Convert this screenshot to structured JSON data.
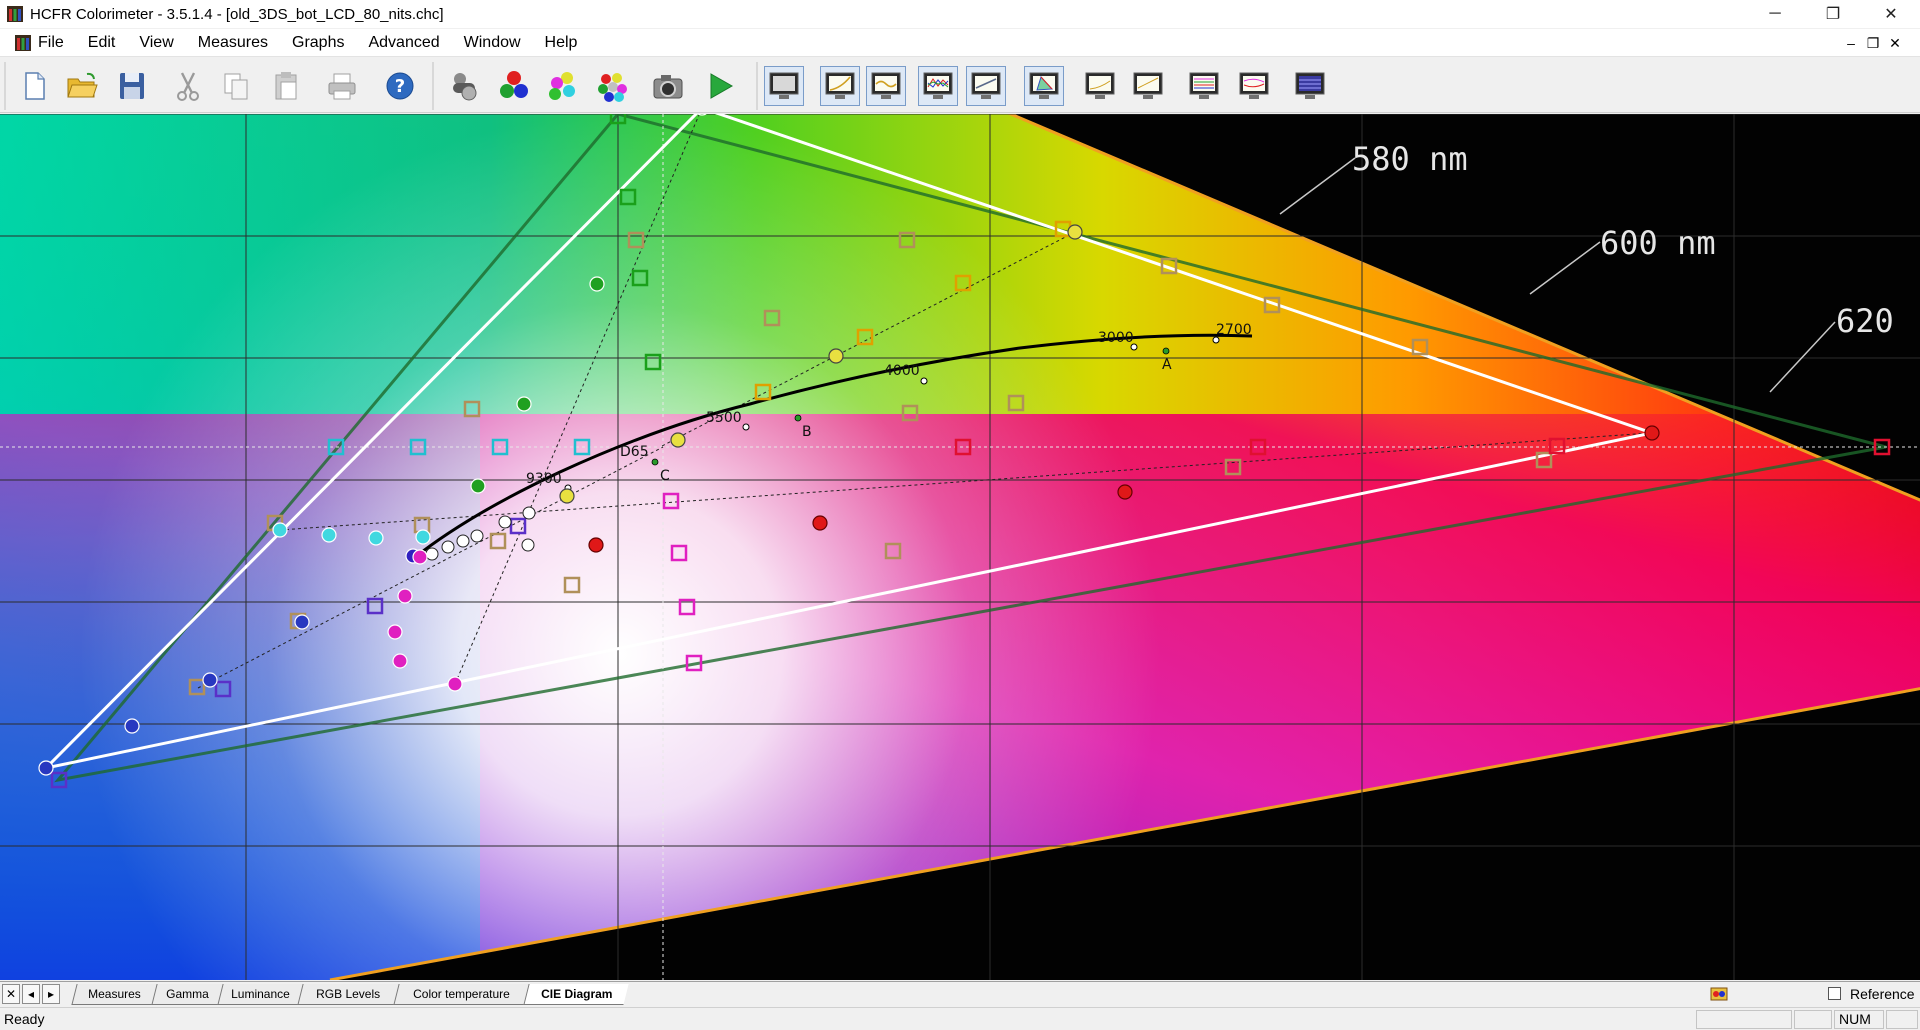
{
  "window": {
    "title": "HCFR Colorimeter - 3.5.1.4 - [old_3DS_bot_LCD_80_nits.chc]",
    "minimize_glyph": "─",
    "restore_glyph": "❐",
    "close_glyph": "✕"
  },
  "menu": {
    "items": [
      "File",
      "Edit",
      "View",
      "Measures",
      "Graphs",
      "Advanced",
      "Window",
      "Help"
    ],
    "mdi_minimize": "–",
    "mdi_restore": "❐",
    "mdi_close": "✕"
  },
  "toolbar": {
    "buttons": [
      "new-document-icon",
      "open-folder-icon",
      "save-icon",
      "cut-icon",
      "copy-icon",
      "paste-icon",
      "print-icon",
      "help-icon",
      "sensor-icon",
      "rgb-primaries-icon",
      "secondary-colors-icon",
      "all-colors-icon",
      "camera-icon",
      "play-icon",
      "view-monitor-icon",
      "gamma-graph-icon",
      "luminance-graph-icon",
      "rgb-levels-graph-icon",
      "color-temperature-graph-icon",
      "cie-diagram-icon",
      "near-black-graph-icon",
      "near-white-graph-icon",
      "saturation-graph-icon",
      "saturation-shift-icon",
      "measures-grid-icon"
    ]
  },
  "diagram": {
    "wavelength_labels": [
      "580  nm",
      "600  nm",
      "620"
    ],
    "cct_labels": [
      "2700",
      "3000",
      "4000",
      "5500",
      "9300"
    ],
    "white_labels": [
      "D65",
      "A",
      "B",
      "C"
    ],
    "colors": {
      "measured_gamut": "#ffffff",
      "reference_gamut": "#1e6a2c",
      "locus_edge": "#f0a020",
      "planckian": "#000000",
      "grid": "#3a3a3a"
    }
  },
  "tabs": {
    "nav": [
      "✕",
      "◂",
      "▸"
    ],
    "items": [
      "Measures",
      "Gamma",
      "Luminance",
      "RGB Levels",
      "Color temperature",
      "CIE Diagram"
    ],
    "active": "CIE Diagram",
    "reference_label": "Reference"
  },
  "status": {
    "text": "Ready",
    "num": "NUM"
  }
}
